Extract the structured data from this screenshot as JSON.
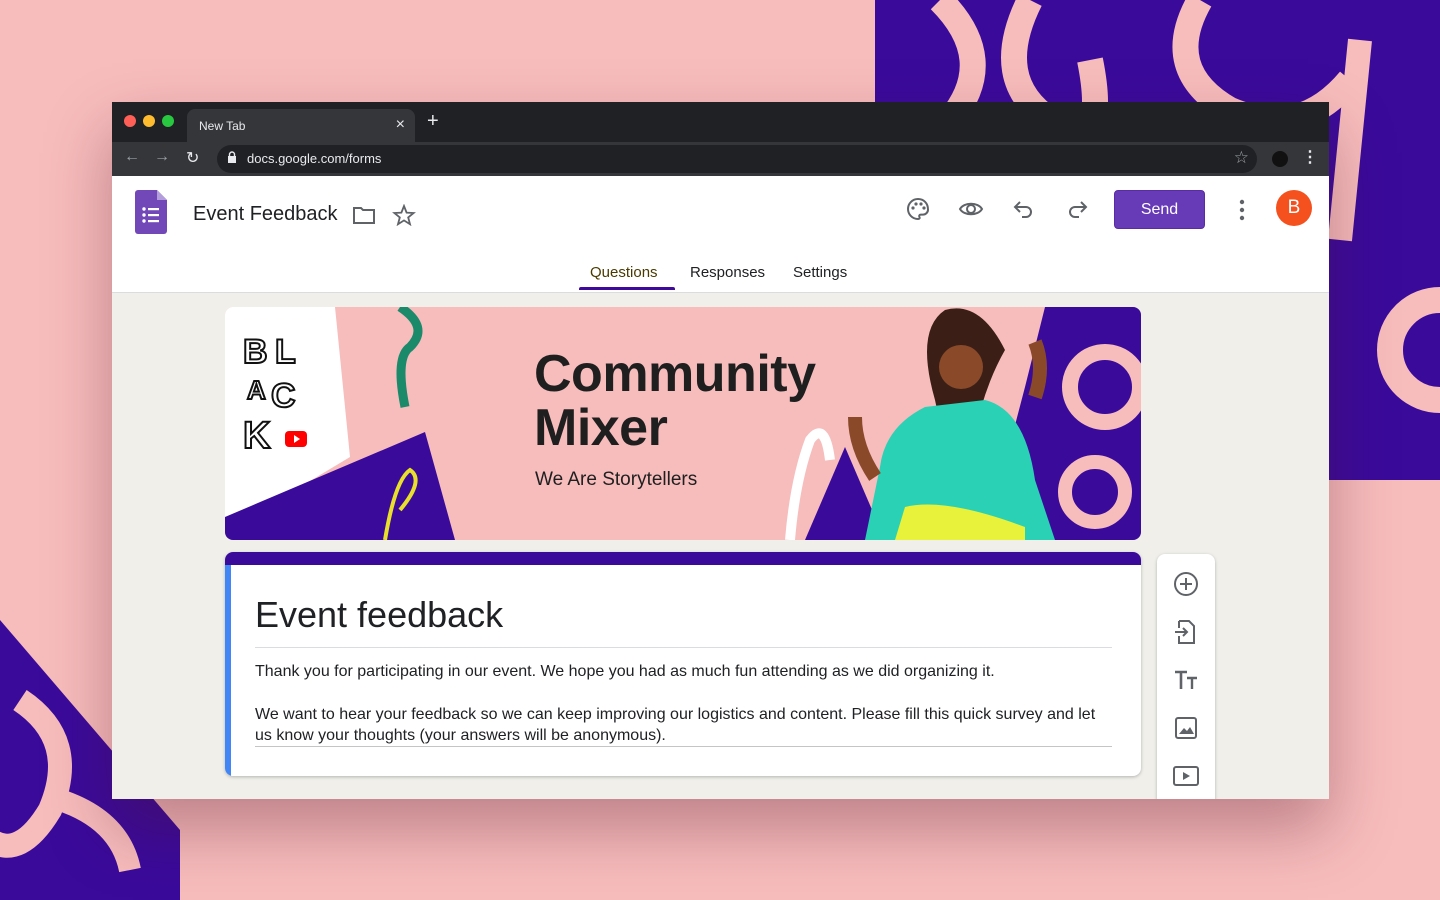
{
  "browser": {
    "tab_title": "New Tab",
    "tab_close": "×",
    "new_tab": "+",
    "url": "docs.google.com/forms",
    "nav": {
      "back": "←",
      "forward": "→",
      "reload": "↻"
    },
    "bookmark_star": "☆",
    "menu": "⋮"
  },
  "forms_header": {
    "doc_title": "Event Feedback",
    "send_label": "Send",
    "avatar_letter": "B",
    "more": "⋮"
  },
  "tabs": [
    {
      "label": "Questions",
      "active": true
    },
    {
      "label": "Responses",
      "active": false
    },
    {
      "label": "Settings",
      "active": false
    }
  ],
  "banner": {
    "logo_letters": [
      "B",
      "L",
      "A",
      "C",
      "K"
    ],
    "title_line1": "Community",
    "title_line2": "Mixer",
    "subtitle": "We Are Storytellers"
  },
  "form": {
    "title": "Event feedback",
    "description_1": "Thank you for participating in our event. We hope you had as much fun attending as we did organizing it.",
    "description_2": "We want to hear your feedback so we can keep improving our logistics and content. Please fill this quick survey and let us know your thoughts (your answers will be anonymous)."
  },
  "side_tools": [
    "add-question-icon",
    "import-questions-icon",
    "add-title-icon",
    "add-image-icon",
    "add-video-icon"
  ],
  "colors": {
    "accent_purple": "#673ab7",
    "theme_indigo": "#3a0a9b",
    "background_pink": "#f7bcbc",
    "avatar_orange": "#f4511e"
  }
}
